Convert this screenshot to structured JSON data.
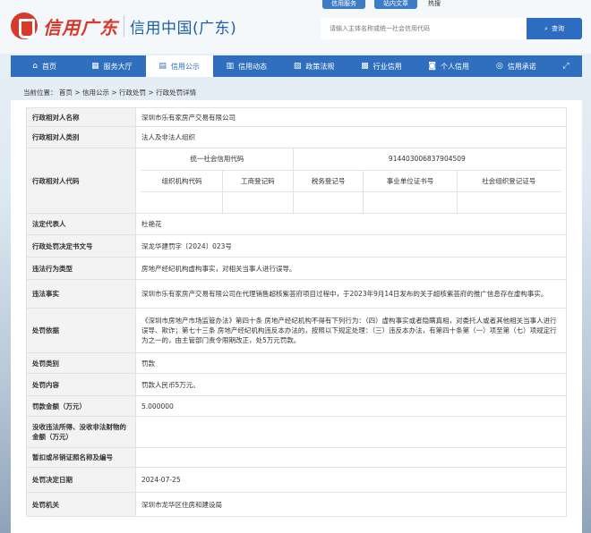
{
  "header": {
    "logo_calligraphy": "信用广东",
    "logo_text": "信用中国(广东)",
    "top_tabs": [
      "信用服务",
      "站内文章",
      "热搜"
    ],
    "search": {
      "placeholder": "请输入主体名称或统一社会信用代码",
      "button_label": "查询"
    }
  },
  "nav": {
    "items": [
      {
        "label": "首页",
        "icon": "home-icon",
        "glyph": "⌂"
      },
      {
        "label": "服务大厅",
        "icon": "grid-icon",
        "glyph": "▦"
      },
      {
        "label": "信用公示",
        "icon": "document-icon",
        "glyph": "▤",
        "active": true
      },
      {
        "label": "信用动态",
        "icon": "news-icon",
        "glyph": "▥"
      },
      {
        "label": "政策法规",
        "icon": "book-icon",
        "glyph": "▧"
      },
      {
        "label": "行业信用",
        "icon": "building-icon",
        "glyph": "▩"
      },
      {
        "label": "个人信用",
        "icon": "user-icon",
        "glyph": "◙"
      },
      {
        "label": "信用承诺",
        "icon": "badge-icon",
        "glyph": "◎"
      }
    ],
    "expand_icon": "expand-icon"
  },
  "breadcrumb": {
    "prefix": "当前位置：",
    "items": [
      "首页",
      "信用公示",
      "行政处罚",
      "行政处罚详情"
    ],
    "separator": " > "
  },
  "detail": {
    "rows": [
      {
        "label": "行政相对人名称",
        "value": "深圳市乐有家房产交易有限公司"
      },
      {
        "label": "行政相对人类别",
        "value": "法人及非法人组织"
      },
      {
        "label": "法定代表人",
        "value": "杜艳花"
      },
      {
        "label": "行政处罚决定书文号",
        "value": "深龙华建罚字〔2024〕023号"
      },
      {
        "label": "违法行为类型",
        "value": "房地产经纪机构虚构事实，对相关当事人进行误导。"
      },
      {
        "label": "违法事实",
        "value": "深圳市乐有家房产交易有限公司在代理销售超核紫荟府项目过程中，于2023年9月14日发布的关于超核紫荟府的推广信息存在虚构事实。"
      },
      {
        "label": "处罚依据",
        "value": "《深圳市房地产市场监管办法》第四十条 房地产经纪机构不得有下列行为：（四）虚构事实或者隐瞒真相，对委托人或者其他相关当事人进行误导、欺诈；第七十三条 房地产经纪机构违反本办法的，按照以下规定处理：（三）违反本办法，有第四十条第（一）项至第（七）项规定行为之一的，由主管部门责令限期改正，处5万元罚款。"
      },
      {
        "label": "处罚类别",
        "value": "罚款"
      },
      {
        "label": "处罚内容",
        "value": "罚款人民币5万元。"
      },
      {
        "label": "罚款金额（万元）",
        "value": "5.000000"
      },
      {
        "label": "没收违法所得、没收非法财物的金额（万元）",
        "value": ""
      },
      {
        "label": "暂扣或吊销证照名称及编号",
        "value": ""
      },
      {
        "label": "处罚决定日期",
        "value": "2024-07-25"
      },
      {
        "label": "处罚机关",
        "value": "深圳市龙华区住房和建设局"
      }
    ],
    "code_row": {
      "label": "行政相对人代码",
      "uscc_header": "统一社会信用代码",
      "uscc_value": "914403006837904509",
      "sub_headers": [
        "组织机构代码",
        "工商登记码",
        "税务登记号",
        "事业单位证书号",
        "社会组织登记证号"
      ],
      "sub_values": [
        "",
        "",
        "",
        "",
        ""
      ]
    }
  }
}
